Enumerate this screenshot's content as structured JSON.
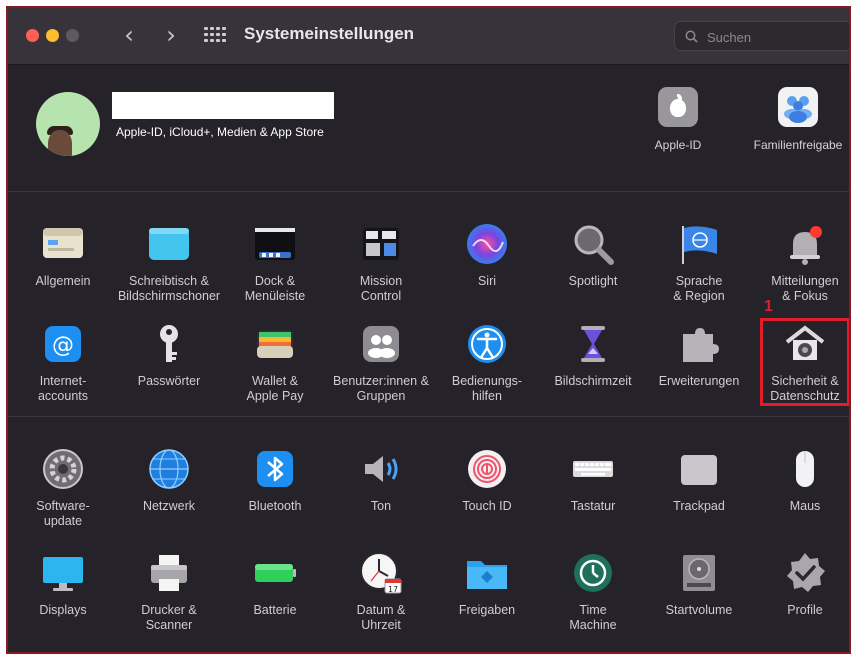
{
  "window": {
    "title": "Systemeinstellungen",
    "search_placeholder": "Suchen"
  },
  "account": {
    "subtitle": "Apple-ID, iCloud+, Medien & App Store",
    "items": [
      {
        "label": "Apple-ID",
        "icon": "apple-icon"
      },
      {
        "label": "Familienfreigabe",
        "icon": "family-icon"
      }
    ]
  },
  "section1": [
    {
      "label": "Allgemein",
      "icon": "general-icon"
    },
    {
      "label": "Schreibtisch &\nBildschirmschoner",
      "icon": "desktop-icon"
    },
    {
      "label": "Dock &\nMenüleiste",
      "icon": "dock-icon"
    },
    {
      "label": "Mission\nControl",
      "icon": "mission-control-icon"
    },
    {
      "label": "Siri",
      "icon": "siri-icon"
    },
    {
      "label": "Spotlight",
      "icon": "spotlight-icon"
    },
    {
      "label": "Sprache\n& Region",
      "icon": "language-icon"
    },
    {
      "label": "Mitteilungen\n& Fokus",
      "icon": "notifications-icon"
    },
    {
      "label": "Internet-\naccounts",
      "icon": "at-icon"
    },
    {
      "label": "Passwörter",
      "icon": "key-icon"
    },
    {
      "label": "Wallet &\nApple Pay",
      "icon": "wallet-icon"
    },
    {
      "label": "Benutzer:innen &\nGruppen",
      "icon": "users-icon"
    },
    {
      "label": "Bedienungs-\nhilfen",
      "icon": "accessibility-icon"
    },
    {
      "label": "Bildschirmzeit",
      "icon": "hourglass-icon"
    },
    {
      "label": "Erweiterungen",
      "icon": "puzzle-icon"
    },
    {
      "label": "Sicherheit &\nDatenschutz",
      "icon": "security-house-icon"
    }
  ],
  "section2": [
    {
      "label": "Software-\nupdate",
      "icon": "gear-icon"
    },
    {
      "label": "Netzwerk",
      "icon": "globe-icon"
    },
    {
      "label": "Bluetooth",
      "icon": "bluetooth-icon"
    },
    {
      "label": "Ton",
      "icon": "speaker-icon"
    },
    {
      "label": "Touch ID",
      "icon": "fingerprint-icon"
    },
    {
      "label": "Tastatur",
      "icon": "keyboard-icon"
    },
    {
      "label": "Trackpad",
      "icon": "trackpad-icon"
    },
    {
      "label": "Maus",
      "icon": "mouse-icon"
    },
    {
      "label": "Displays",
      "icon": "display-icon"
    },
    {
      "label": "Drucker &\nScanner",
      "icon": "printer-icon"
    },
    {
      "label": "Batterie",
      "icon": "battery-icon"
    },
    {
      "label": "Datum &\nUhrzeit",
      "icon": "clock-icon"
    },
    {
      "label": "Freigaben",
      "icon": "folder-icon"
    },
    {
      "label": "Time\nMachine",
      "icon": "time-machine-icon"
    },
    {
      "label": "Startvolume",
      "icon": "disk-icon"
    },
    {
      "label": "Profile",
      "icon": "badge-check-icon"
    }
  ],
  "annotation": {
    "number": "1",
    "color": "#e21d2a"
  }
}
